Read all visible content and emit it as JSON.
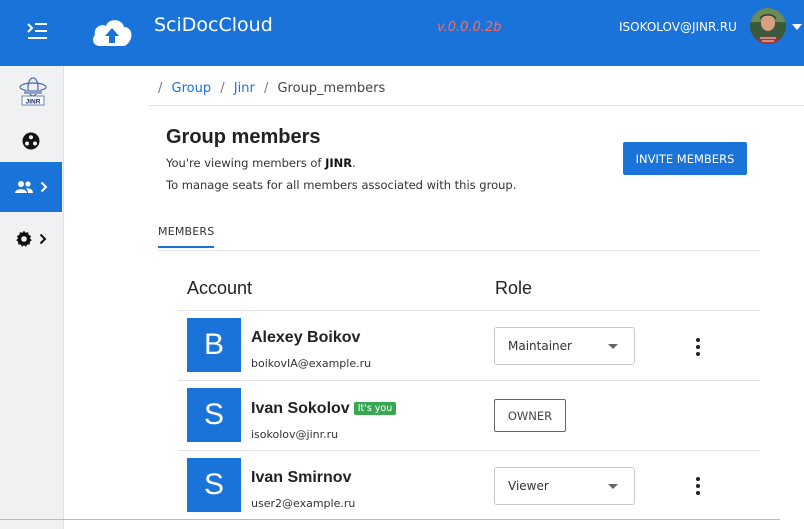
{
  "header": {
    "app_title": "SciDocCloud",
    "version": "v.0.0.0.2b",
    "user_email": "ISOKOLOV@JINR.RU",
    "brand_color": "#1a73d9",
    "version_color": "#ff6b5b"
  },
  "rail": {
    "logo": "JINR",
    "items": [
      {
        "name": "community-icon",
        "active": false
      },
      {
        "name": "group-icon",
        "active": true
      },
      {
        "name": "settings-icon",
        "active": false
      }
    ]
  },
  "breadcrumb": {
    "root_sep": "/",
    "items": [
      "Group",
      "Jinr",
      "Group_members"
    ]
  },
  "page": {
    "title": "Group members",
    "subtitle_prefix": "You're viewing members of ",
    "subtitle_group": "JINR",
    "subtitle_suffix": ".",
    "subtitle2": "To manage seats for all members associated with this group.",
    "invite_button": "INVITE MEMBERS"
  },
  "tabs": [
    {
      "label": "MEMBERS",
      "active": true
    }
  ],
  "table": {
    "headers": {
      "account": "Account",
      "role": "Role"
    },
    "rows": [
      {
        "initial": "B",
        "name": "Alexey Boikov",
        "email": "boikovIA@example.ru",
        "role": "Maintainer",
        "badge": "",
        "editable": true
      },
      {
        "initial": "S",
        "name": "Ivan Sokolov",
        "email": "isokolov@jinr.ru",
        "role": "OWNER",
        "badge": "It's you",
        "editable": false
      },
      {
        "initial": "S",
        "name": "Ivan Smirnov",
        "email": "user2@example.ru",
        "role": "Viewer",
        "badge": "",
        "editable": true
      }
    ]
  }
}
